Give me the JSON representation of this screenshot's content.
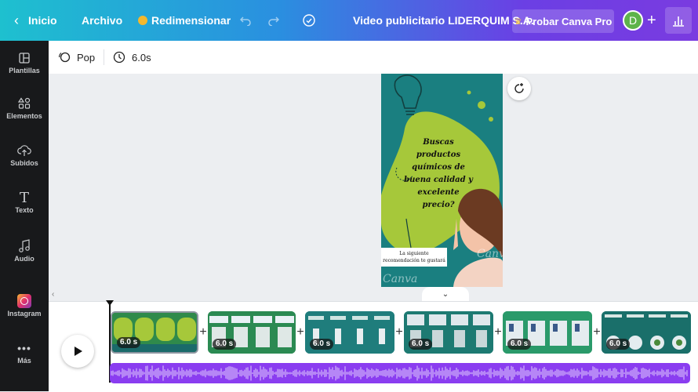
{
  "topbar": {
    "home_label": "Inicio",
    "file_label": "Archivo",
    "resize_label": "Redimensionar",
    "doc_title": "Video publicitario LIDERQUIM S.A.",
    "pro_label": "Probar Canva Pro",
    "avatar_initial": "D",
    "plus_label": "+"
  },
  "sidebar": {
    "items": [
      {
        "label": "Plantillas",
        "icon": "templates-icon"
      },
      {
        "label": "Elementos",
        "icon": "elements-icon"
      },
      {
        "label": "Subidos",
        "icon": "upload-icon"
      },
      {
        "label": "Texto",
        "icon": "text-icon"
      },
      {
        "label": "Audio",
        "icon": "audio-icon"
      },
      {
        "label": "Instagram",
        "icon": "instagram-icon"
      },
      {
        "label": "Más",
        "icon": "more-icon"
      }
    ]
  },
  "toolbar": {
    "animation_label": "Pop",
    "duration_label": "6.0s"
  },
  "design": {
    "headline": "Buscas productos químicos de buena calidad y excelente precio?",
    "caption": "La siguiente recomendación te gustará",
    "watermark": "Canva"
  },
  "timeline": {
    "clips": [
      {
        "duration": "6.0 s",
        "selected": true
      },
      {
        "duration": "6.0 s",
        "selected": false
      },
      {
        "duration": "6.0 s",
        "selected": false
      },
      {
        "duration": "6.0 s",
        "selected": false
      },
      {
        "duration": "6.0 s",
        "selected": false
      },
      {
        "duration": "6.0 s",
        "selected": false
      }
    ]
  },
  "colors": {
    "topbar_start": "#1ec0cf",
    "topbar_end": "#7a3be0",
    "sidebar_bg": "#18191b",
    "design_teal": "#1a7f80",
    "design_lime": "#a6c83a",
    "audio_track": "#8a3df0"
  }
}
